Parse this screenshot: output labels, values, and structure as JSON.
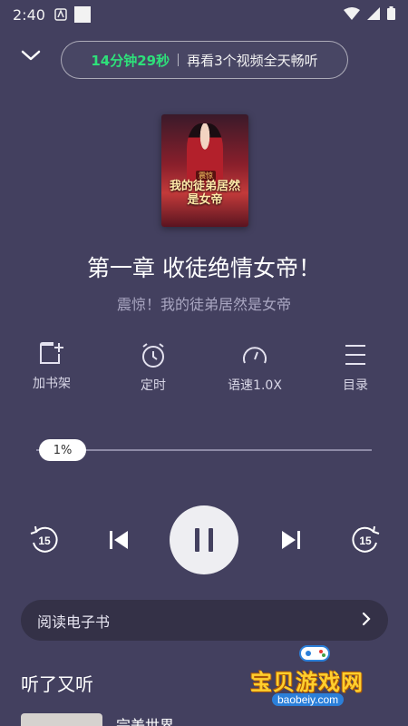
{
  "status_bar": {
    "time": "2:40"
  },
  "timer": {
    "countdown": "14分钟29秒",
    "promo": "再看3个视频全天畅听"
  },
  "book": {
    "cover_title": "我的徒弟居然是女帝",
    "cover_badge": "震惊",
    "chapter_title": "第一章 收徒绝情女帝！",
    "book_title": "震惊！我的徒弟居然是女帝"
  },
  "actions": [
    {
      "label": "加书架",
      "icon": "add-bookshelf-icon"
    },
    {
      "label": "定时",
      "icon": "timer-icon"
    },
    {
      "label": "语速1.0X",
      "icon": "speed-icon"
    },
    {
      "label": "目录",
      "icon": "menu-icon"
    }
  ],
  "progress": {
    "label": "1%",
    "value": 0.01
  },
  "player": {
    "rewind_seconds": "15",
    "forward_seconds": "15"
  },
  "ebook": {
    "label": "阅读电子书"
  },
  "section": {
    "title": "听了又听"
  },
  "recommendation": {
    "title": "完美世界"
  },
  "watermark": {
    "text": "宝贝游戏网",
    "url": "baobeiy.com"
  },
  "colors": {
    "background": "#43405f",
    "accent_green": "#2ee07a",
    "bar": "#343147"
  }
}
